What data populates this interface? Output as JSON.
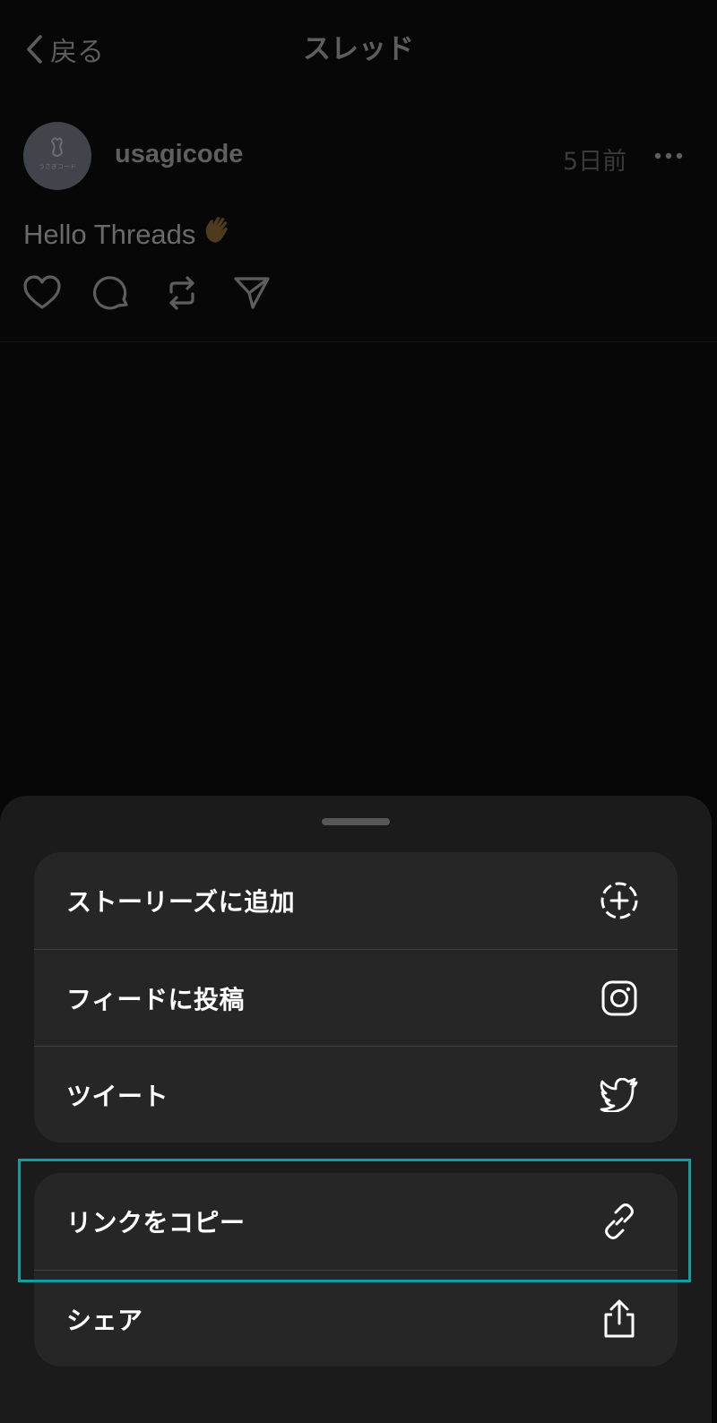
{
  "nav": {
    "back_label": "戻る",
    "title": "スレッド"
  },
  "post": {
    "username": "usagicode",
    "avatar_text": "うさぎコード",
    "time": "5日前",
    "text": "Hello Threads",
    "emoji": "👋"
  },
  "sheet": {
    "group1": [
      {
        "label": "ストーリーズに追加",
        "icon": "add-story-icon"
      },
      {
        "label": "フィードに投稿",
        "icon": "instagram-icon"
      },
      {
        "label": "ツイート",
        "icon": "twitter-icon"
      }
    ],
    "group2": [
      {
        "label": "リンクをコピー",
        "icon": "link-icon"
      },
      {
        "label": "シェア",
        "icon": "share-icon"
      }
    ]
  },
  "colors": {
    "highlight": "#139e9a",
    "sheet_bg": "#1b1b1b",
    "row_bg": "#262626"
  }
}
